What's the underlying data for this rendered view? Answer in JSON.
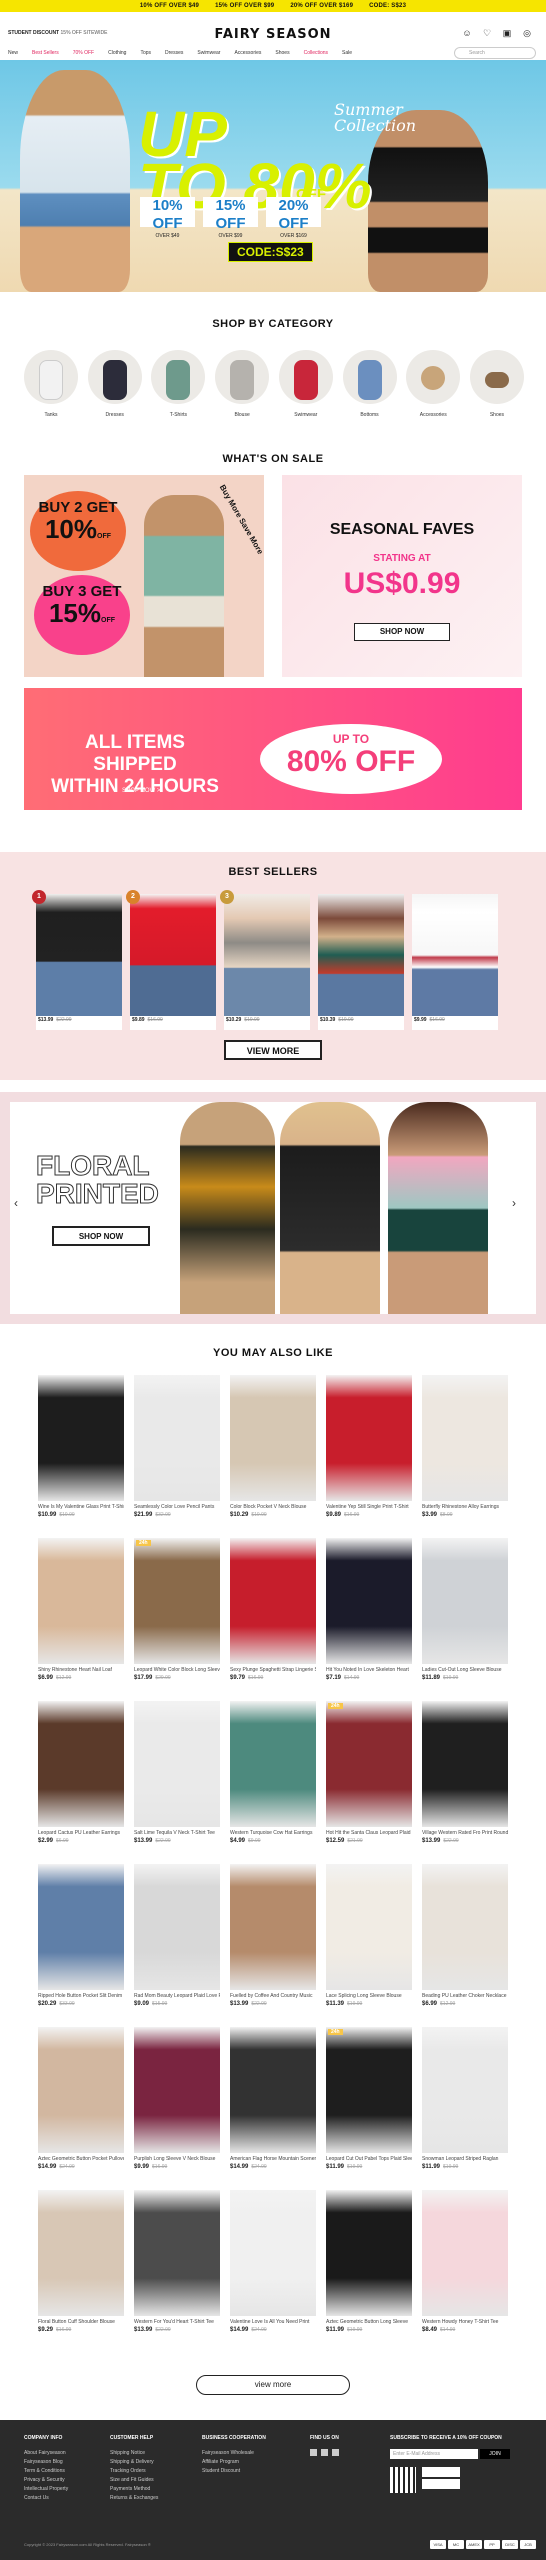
{
  "promo": [
    "10% OFF OVER $49",
    "15% OFF OVER $99",
    "20% OFF OVER $169",
    "CODE: S$23"
  ],
  "header": {
    "logo": "FAIRY SEASON",
    "student": "STUDENT DISCOUNT",
    "student_extra": "15% OFF SITEWIDE",
    "search_placeholder": "Search",
    "nav": [
      "New",
      "Best Sellers",
      "70% OFF",
      "Clothing",
      "Tops",
      "Dresses",
      "Swimwear",
      "Accessories",
      "Shoes",
      "Collections",
      "Sale"
    ]
  },
  "hero": {
    "headline1": "UP",
    "headline2": "TO 80%",
    "off": "OFF",
    "script1": "Summer",
    "script2": "Collection",
    "tiers": [
      {
        "pct": "10% OFF",
        "min": "OVER $49"
      },
      {
        "pct": "15% OFF",
        "min": "OVER $99"
      },
      {
        "pct": "20% OFF",
        "min": "OVER $169"
      }
    ],
    "code": "CODE:S$23"
  },
  "categories": {
    "title": "SHOP BY CATEGORY",
    "items": [
      "Tanks",
      "Dresses",
      "T-Shirts",
      "Blouse",
      "Swimwear",
      "Bottoms",
      "Accessories",
      "Shoes"
    ]
  },
  "sale": {
    "title": "WHAT'S ON SALE",
    "buy2": "BUY 2 GET",
    "buy2pct": "10%",
    "buy3": "BUY 3 GET",
    "buy3pct": "15%",
    "off": "OFF",
    "side": "Buy More Save More",
    "sf_title": "SEASONAL FAVES",
    "sf_sub": "STATING AT",
    "sf_price": "US$0.99",
    "sf_btn": "SHOP NOW"
  },
  "ship": {
    "line1": "ALL ITEMS SHIPPED",
    "line2": "WITHIN 24 HOURS",
    "link": "SHOP NOW >",
    "upto": "UP TO",
    "pct": "80% OFF"
  },
  "best": {
    "title": "BEST SELLERS",
    "btn": "VIEW MORE",
    "items": [
      {
        "p": "$13.99",
        "o": "$22.99"
      },
      {
        "p": "$9.89",
        "o": "$16.99"
      },
      {
        "p": "$10.29",
        "o": "$19.99"
      },
      {
        "p": "$10.39",
        "o": "$19.99"
      },
      {
        "p": "$9.99",
        "o": "$16.99"
      }
    ]
  },
  "floral": {
    "title1": "FLORAL",
    "title2": "PRINTED",
    "btn": "SHOP NOW"
  },
  "also": {
    "title": "YOU MAY ALSO LIKE",
    "items": [
      {
        "t": "Wine Is My Valentine Glass Print T-Shirt",
        "p": "$10.99",
        "o": "$19.99"
      },
      {
        "t": "Seamlessly Color Love Pencil Pants",
        "p": "$21.99",
        "o": "$32.99"
      },
      {
        "t": "Color Block Pocket V Neck Blouse",
        "p": "$10.29",
        "o": "$19.99"
      },
      {
        "t": "Valentine Yep Still Single Print T-Shirt",
        "p": "$9.89",
        "o": "$16.99"
      },
      {
        "t": "Butterfly Rhinestone Alloy Earrings",
        "p": "$3.99",
        "o": "$8.99"
      },
      {
        "t": "Shiny Rhinestone Heart Nail Loaf",
        "p": "$6.99",
        "o": "$12.99"
      },
      {
        "t": "Leopard White Color Block Long Sleeve",
        "p": "$17.99",
        "o": "$29.99"
      },
      {
        "t": "Sexy Plunge Spaghetti Strap Lingerie Set",
        "p": "$9.79",
        "o": "$16.99"
      },
      {
        "t": "Hit You Noted In Love Skeleton Heart",
        "p": "$7.19",
        "o": "$14.99"
      },
      {
        "t": "Ladies Cut-Out Long Sleeve Blouse",
        "p": "$11.89",
        "o": "$19.99"
      },
      {
        "t": "Leopard Cactus PU Leather Earrings",
        "p": "$2.99",
        "o": "$6.99"
      },
      {
        "t": "Salt Lime Tequila V Neck T-Shirt Tee",
        "p": "$13.99",
        "o": "$22.99"
      },
      {
        "t": "Western Turquoise Cow Hat Earrings",
        "p": "$4.99",
        "o": "$9.99"
      },
      {
        "t": "Hot Hit the Santa Claus Leopard Plaid",
        "p": "$12.59",
        "o": "$21.99"
      },
      {
        "t": "Village Western Rated Fro Print Round",
        "p": "$13.99",
        "o": "$22.99"
      },
      {
        "t": "Ripped Hole Button Pocket Slit Denim",
        "p": "$20.29",
        "o": "$33.99"
      },
      {
        "t": "Rad Mom Beauty Leopard Plaid Love Print",
        "p": "$9.09",
        "o": "$15.99"
      },
      {
        "t": "Fuelled by Coffee And Country Music",
        "p": "$13.99",
        "o": "$22.99"
      },
      {
        "t": "Lace Splicing Long Sleeve Blouse",
        "p": "$11.39",
        "o": "$19.99"
      },
      {
        "t": "Beading PU Leather Choker Necklace",
        "p": "$6.99",
        "o": "$12.99"
      },
      {
        "t": "Aztec Geometric Button Pocket Pullover",
        "p": "$14.99",
        "o": "$24.99"
      },
      {
        "t": "Purplish Long Sleeve V Neck Blouse",
        "p": "$9.99",
        "o": "$16.99"
      },
      {
        "t": "American Flag Horse Mountain Scenery",
        "p": "$14.99",
        "o": "$24.99"
      },
      {
        "t": "Leopard Cut Out Pabel Tops Plaid Sleeve",
        "p": "$11.99",
        "o": "$19.99"
      },
      {
        "t": "Snowman Leopard Striped Raglan",
        "p": "$11.99",
        "o": "$19.99"
      },
      {
        "t": "Floral Button Cuff Shoulder Blouse",
        "p": "$9.29",
        "o": "$16.99"
      },
      {
        "t": "Western For You'd Heart T-Shirt Tee",
        "p": "$13.99",
        "o": "$22.99"
      },
      {
        "t": "Valentine Love Is All You Need Print",
        "p": "$14.99",
        "o": "$24.99"
      },
      {
        "t": "Aztec Geometric Button Long Sleeve",
        "p": "$11.99",
        "o": "$19.99"
      },
      {
        "t": "Western Howdy Honey T-Shirt Tee",
        "p": "$8.49",
        "o": "$14.99"
      }
    ],
    "btn": "view more"
  },
  "footer": {
    "cols": [
      {
        "h": "COMPANY INFO",
        "l": [
          "About Fairyseason",
          "Fairyseason Blog",
          "Term & Conditions",
          "Privacy & Security",
          "Intellectual Property",
          "Contact Us"
        ]
      },
      {
        "h": "CUSTOMER HELP",
        "l": [
          "Shipping Notice",
          "Shipping & Delivery",
          "Tracking Orders",
          "Size and Fit Guides",
          "Payments Method",
          "Returns & Exchanges"
        ]
      },
      {
        "h": "BUSINESS COOPERATION",
        "l": [
          "Fairyseason Wholesale",
          "Affiliate Program",
          "Student Discount"
        ]
      }
    ],
    "follow": "FIND US ON",
    "subscribe": "SUBSCRIBE TO RECEIVE A 10% OFF COUPON",
    "email_placeholder": "Enter E-Mail Address",
    "join": "JOIN",
    "copyright": "Copyright © 2023 Fairyseason.com All Rights Reserved. Fairyseason ®",
    "pay": [
      "VISA",
      "MC",
      "AMEX",
      "PP",
      "DISC",
      "JCB"
    ]
  }
}
